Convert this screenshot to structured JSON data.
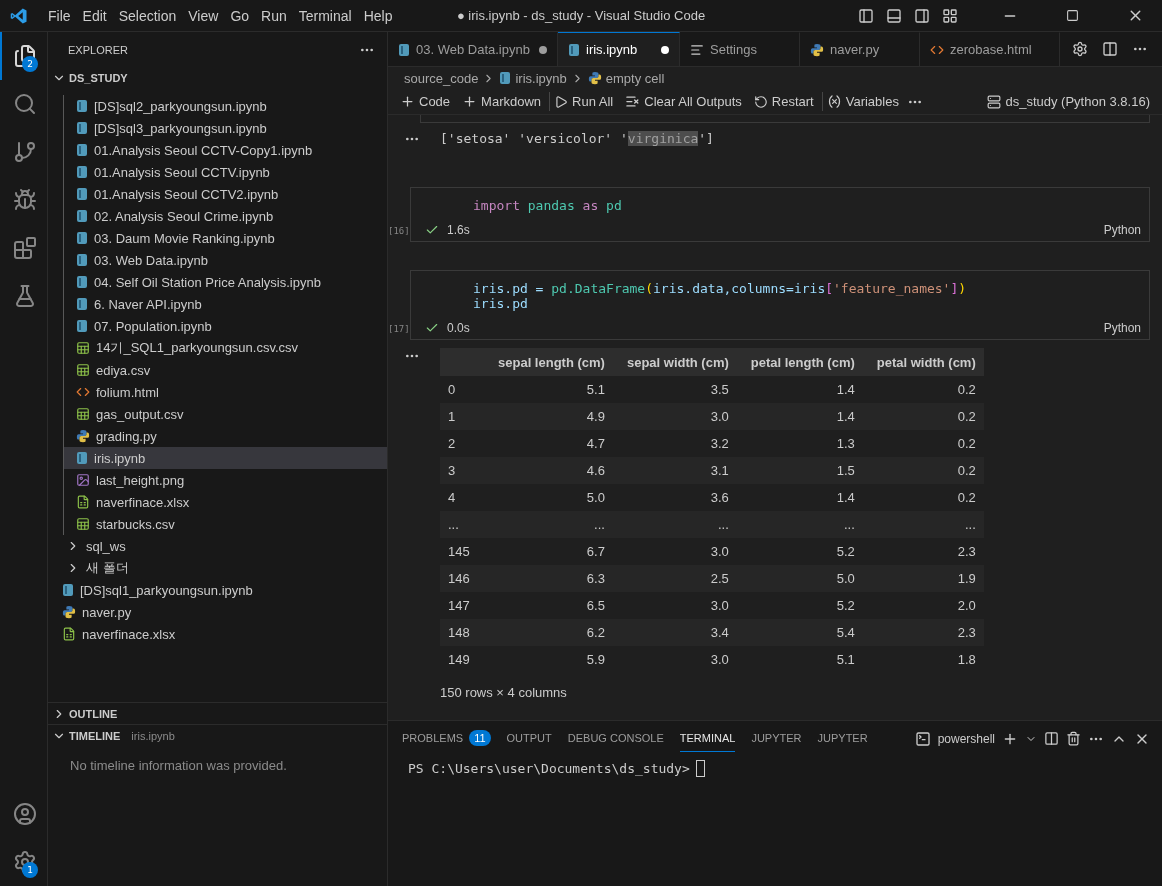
{
  "window": {
    "title": "● iris.ipynb - ds_study - Visual Studio Code"
  },
  "menu": [
    "File",
    "Edit",
    "Selection",
    "View",
    "Go",
    "Run",
    "Terminal",
    "Help"
  ],
  "activity_bar": {
    "top": [
      {
        "kind": "explorer",
        "selected": true,
        "badge": "2"
      },
      {
        "kind": "search",
        "selected": false
      },
      {
        "kind": "source-control",
        "selected": false
      },
      {
        "kind": "run-debug",
        "selected": false
      },
      {
        "kind": "extensions",
        "selected": false
      },
      {
        "kind": "testing",
        "selected": false
      }
    ],
    "bottom": [
      {
        "kind": "account",
        "selected": false
      },
      {
        "kind": "settings",
        "selected": false,
        "badge": "1"
      }
    ]
  },
  "sidebar": {
    "title": "EXPLORER",
    "root": {
      "label": "DS_STUDY",
      "expanded": true,
      "children": [
        {
          "kind": "scrolled-folder",
          "children": [
            {
              "label": "[DS]sql2_parkyoungsun.ipynb",
              "kind": "notebook",
              "selected": false
            },
            {
              "label": "[DS]sql3_parkyoungsun.ipynb",
              "kind": "notebook",
              "selected": false
            },
            {
              "label": "01.Analysis Seoul CCTV-Copy1.ipynb",
              "kind": "notebook",
              "selected": false
            },
            {
              "label": "01.Analysis Seoul CCTV.ipynb",
              "kind": "notebook",
              "selected": false
            },
            {
              "label": "01.Analysis Seoul CCTV2.ipynb",
              "kind": "notebook",
              "selected": false
            },
            {
              "label": "02. Analysis Seoul Crime.ipynb",
              "kind": "notebook",
              "selected": false
            },
            {
              "label": "03. Daum Movie Ranking.ipynb",
              "kind": "notebook",
              "selected": false
            },
            {
              "label": "03. Web Data.ipynb",
              "kind": "notebook",
              "selected": false
            },
            {
              "label": "04. Self Oil Station Price Analysis.ipynb",
              "kind": "notebook",
              "selected": false
            },
            {
              "label": "6. Naver API.ipynb",
              "kind": "notebook",
              "selected": false
            },
            {
              "label": "07. Population.ipynb",
              "kind": "notebook",
              "selected": false
            },
            {
              "label": "14기_SQL1_parkyoungsun.csv.csv",
              "kind": "csv",
              "selected": false
            },
            {
              "label": "ediya.csv",
              "kind": "csv",
              "selected": false
            },
            {
              "label": "folium.html",
              "kind": "html",
              "selected": false
            },
            {
              "label": "gas_output.csv",
              "kind": "csv",
              "selected": false
            },
            {
              "label": "grading.py",
              "kind": "python",
              "selected": false
            },
            {
              "label": "iris.ipynb",
              "kind": "notebook",
              "selected": true
            },
            {
              "label": "last_height.png",
              "kind": "image",
              "selected": false
            },
            {
              "label": "naverfinace.xlsx",
              "kind": "excel",
              "selected": false
            },
            {
              "label": "starbucks.csv",
              "kind": "csv",
              "selected": false
            }
          ]
        },
        {
          "label": "sql_ws",
          "kind": "folder",
          "expanded": false,
          "selected": false
        },
        {
          "label": "새 폴더",
          "kind": "folder",
          "expanded": false,
          "selected": false
        },
        {
          "label": "[DS]sql1_parkyoungsun.ipynb",
          "kind": "notebook",
          "selected": false
        },
        {
          "label": "naver.py",
          "kind": "python",
          "selected": false
        },
        {
          "label": "naverfinace.xlsx",
          "kind": "excel",
          "selected": false
        }
      ]
    },
    "sections": [
      {
        "label": "OUTLINE",
        "expanded": false
      },
      {
        "label": "TIMELINE",
        "expanded": true,
        "detail": "iris.ipynb",
        "message": "No timeline information was provided."
      }
    ]
  },
  "editor_tabs": [
    {
      "label": "03. Web Data.ipynb",
      "kind": "notebook",
      "dirty": true,
      "selected": false
    },
    {
      "label": "iris.ipynb",
      "kind": "notebook",
      "dirty": true,
      "selected": true
    },
    {
      "label": "Settings",
      "kind": "settings",
      "dirty": false,
      "selected": false
    },
    {
      "label": "naver.py",
      "kind": "python",
      "dirty": false,
      "selected": false
    },
    {
      "label": "zerobase.html",
      "kind": "html",
      "dirty": false,
      "selected": false
    }
  ],
  "breadcrumb": [
    {
      "label": "source_code",
      "kind": "folder"
    },
    {
      "label": "iris.ipynb",
      "kind": "notebook"
    },
    {
      "label": "empty cell",
      "kind": "python"
    }
  ],
  "notebook_toolbar": [
    {
      "kind": "add",
      "label": "Code"
    },
    {
      "kind": "add",
      "label": "Markdown"
    },
    {
      "kind": "run-all",
      "label": "Run All"
    },
    {
      "kind": "clear",
      "label": "Clear All Outputs"
    },
    {
      "kind": "restart",
      "label": "Restart"
    },
    {
      "kind": "variables",
      "label": "Variables"
    }
  ],
  "kernel": "ds_study (Python 3.8.16)",
  "cells": [
    {
      "kind": "output-text",
      "segments": [
        {
          "text": "['setosa' 'versicolor' '",
          "highlighted": false
        },
        {
          "text": "virginica",
          "highlighted": true
        },
        {
          "text": "']",
          "highlighted": false
        }
      ]
    },
    {
      "kind": "code",
      "count": "[16]",
      "succeeded": true,
      "time": "1.6s",
      "language": "Python",
      "lines": [
        [
          {
            "text": "import",
            "kind": "keyword"
          },
          {
            "text": " pandas",
            "kind": "module"
          },
          {
            "text": " as",
            "kind": "keyword"
          },
          {
            "text": " pd",
            "kind": "module"
          }
        ]
      ]
    },
    {
      "kind": "code",
      "count": "[17]",
      "succeeded": true,
      "time": "0.0s",
      "language": "Python",
      "lines": [
        [
          {
            "text": "iris.pd = ",
            "kind": "plain"
          },
          {
            "text": "pd.DataFrame",
            "kind": "module"
          },
          {
            "text": "(",
            "kind": "bracket1"
          },
          {
            "text": "iris.data,columns=iris",
            "kind": "plain"
          },
          {
            "text": "[",
            "kind": "bracket2"
          },
          {
            "text": "'feature_names'",
            "kind": "string"
          },
          {
            "text": "]",
            "kind": "bracket2"
          },
          {
            "text": ")",
            "kind": "bracket1"
          }
        ],
        [
          {
            "text": "iris.pd",
            "kind": "plain"
          }
        ]
      ]
    },
    {
      "kind": "output-table",
      "columns": [
        "",
        "sepal length (cm)",
        "sepal width (cm)",
        "petal length (cm)",
        "petal width (cm)"
      ],
      "rows": [
        [
          "0",
          "5.1",
          "3.5",
          "1.4",
          "0.2"
        ],
        [
          "1",
          "4.9",
          "3.0",
          "1.4",
          "0.2"
        ],
        [
          "2",
          "4.7",
          "3.2",
          "1.3",
          "0.2"
        ],
        [
          "3",
          "4.6",
          "3.1",
          "1.5",
          "0.2"
        ],
        [
          "4",
          "5.0",
          "3.6",
          "1.4",
          "0.2"
        ],
        [
          "...",
          "...",
          "...",
          "...",
          "..."
        ],
        [
          "145",
          "6.7",
          "3.0",
          "5.2",
          "2.3"
        ],
        [
          "146",
          "6.3",
          "2.5",
          "5.0",
          "1.9"
        ],
        [
          "147",
          "6.5",
          "3.0",
          "5.2",
          "2.0"
        ],
        [
          "148",
          "6.2",
          "3.4",
          "5.4",
          "2.3"
        ],
        [
          "149",
          "5.9",
          "3.0",
          "5.1",
          "1.8"
        ]
      ],
      "summary": "150 rows × 4 columns"
    }
  ],
  "panel": {
    "tabs": [
      {
        "label": "PROBLEMS",
        "badge": "11",
        "selected": false
      },
      {
        "label": "OUTPUT",
        "selected": false
      },
      {
        "label": "DEBUG CONSOLE",
        "selected": false
      },
      {
        "label": "TERMINAL",
        "selected": true
      },
      {
        "label": "JUPYTER",
        "selected": false
      },
      {
        "label": "JUPYTER",
        "selected": false
      }
    ],
    "shell": "powershell",
    "prompt": "PS C:\\Users\\user\\Documents\\ds_study>"
  }
}
